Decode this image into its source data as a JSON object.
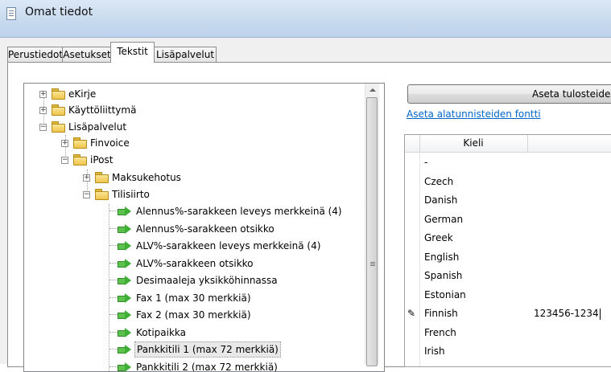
{
  "window": {
    "title": "Omat tiedot"
  },
  "tabs": [
    {
      "label": "Perustiedot"
    },
    {
      "label": "Asetukset"
    },
    {
      "label": "Tekstit",
      "active": true
    },
    {
      "label": "Lisäpalvelut"
    }
  ],
  "tree": {
    "items": [
      {
        "label": "eKirje",
        "kind": "folder",
        "expanded": false
      },
      {
        "label": "Käyttöliittymä",
        "kind": "folder",
        "expanded": false
      },
      {
        "label": "Lisäpalvelut",
        "kind": "folder",
        "expanded": true
      },
      {
        "label": "Finvoice",
        "kind": "folder",
        "expanded": false
      },
      {
        "label": "iPost",
        "kind": "folder",
        "expanded": true
      },
      {
        "label": "Maksukehotus",
        "kind": "folder",
        "expanded": false
      },
      {
        "label": "Tilisiirto",
        "kind": "folder",
        "expanded": true
      },
      {
        "label": "Alennus%-sarakkeen leveys merkkeinä (4)",
        "kind": "item"
      },
      {
        "label": "Alennus%-sarakkeen otsikko",
        "kind": "item"
      },
      {
        "label": "ALV%-sarakkeen leveys merkkeinä (4)",
        "kind": "item"
      },
      {
        "label": "ALV%-sarakkeen otsikko",
        "kind": "item"
      },
      {
        "label": "Desimaaleja yksikköhinnassa",
        "kind": "item"
      },
      {
        "label": "Fax 1 (max 30 merkkiä)",
        "kind": "item"
      },
      {
        "label": "Fax 2 (max 30 merkkiä)",
        "kind": "item"
      },
      {
        "label": "Kotipaikka",
        "kind": "item"
      },
      {
        "label": "Pankkitili 1 (max 72 merkkiä)",
        "kind": "item",
        "selected": true
      },
      {
        "label": "Pankkitili 2 (max 72 merkkiä)",
        "kind": "item"
      }
    ]
  },
  "right": {
    "button_label": "Aseta tulosteide",
    "link_label": "Aseta alatunnisteiden fontti"
  },
  "grid": {
    "column_header": "Kieli",
    "rows": [
      {
        "lang": "-",
        "value": ""
      },
      {
        "lang": "Czech",
        "value": ""
      },
      {
        "lang": "Danish",
        "value": ""
      },
      {
        "lang": "German",
        "value": ""
      },
      {
        "lang": "Greek",
        "value": ""
      },
      {
        "lang": "English",
        "value": ""
      },
      {
        "lang": "Spanish",
        "value": ""
      },
      {
        "lang": "Estonian",
        "value": ""
      },
      {
        "lang": "Finnish",
        "value": "123456-1234",
        "editing": true
      },
      {
        "lang": "French",
        "value": ""
      },
      {
        "lang": "Irish",
        "value": ""
      }
    ],
    "edit_indicator": "✎"
  }
}
